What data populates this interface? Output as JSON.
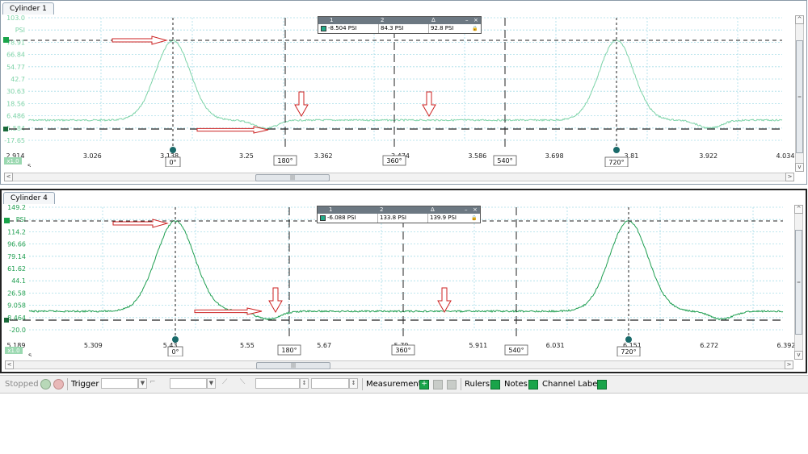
{
  "panels": [
    {
      "tab": "Cylinder 1",
      "unit": "PSI",
      "y_ticks": [
        "103.0",
        "PSI",
        "78.91",
        "66.84",
        "54.77",
        "42.7",
        "30.63",
        "18.56",
        "6.486",
        "-5.584",
        "-17.65"
      ],
      "x_ticks": [
        "2.914",
        "3.026",
        "3.138",
        "3.25",
        "3.362",
        "3.474",
        "3.586",
        "3.698",
        "3.81",
        "3.922",
        "4.034"
      ],
      "x_unit": "s",
      "zoom_badge": "x1.0",
      "rulers": [
        "0°",
        "180°",
        "360°",
        "540°",
        "720°"
      ],
      "measurement": {
        "h1": "1",
        "h2": "2",
        "h3": "Δ",
        "v1": "-8.504 PSI",
        "v2": "84.3 PSI",
        "v3": "92.8 PSI"
      },
      "color": "#7dd3a8"
    },
    {
      "tab": "Cylinder 4",
      "unit": "PSI",
      "y_ticks": [
        "149.2",
        "PSI",
        "114.2",
        "96.66",
        "79.14",
        "61.62",
        "44.1",
        "26.58",
        "9.058",
        "-8.464",
        "-20.0"
      ],
      "x_ticks": [
        "5.189",
        "5.309",
        "5.43",
        "5.55",
        "5.67",
        "5.79",
        "5.911",
        "6.031",
        "6.151",
        "6.272",
        "6.392"
      ],
      "x_unit": "s",
      "zoom_badge": "x1.0",
      "rulers": [
        "0°",
        "180°",
        "360°",
        "540°",
        "720°"
      ],
      "measurement": {
        "h1": "1",
        "h2": "2",
        "h3": "Δ",
        "v1": "-6.088 PSI",
        "v2": "133.8 PSI",
        "v3": "139.9 PSI"
      },
      "color": "#1e9e50"
    }
  ],
  "toolbar": {
    "status": "Stopped",
    "trigger": "Trigger",
    "measurements": "Measurements",
    "rulers": "Rulers",
    "notes": "Notes",
    "channel_labels": "Channel Labels"
  },
  "scroll": {
    "grip": "|||",
    "left": "<",
    "right": ">",
    "up": "^",
    "down": "v",
    "vgrip": "="
  },
  "colors": {
    "grid": "#a8dde8",
    "ruler": "#222222",
    "arrow": "#cc2222",
    "marker": "#1a6a6a"
  }
}
